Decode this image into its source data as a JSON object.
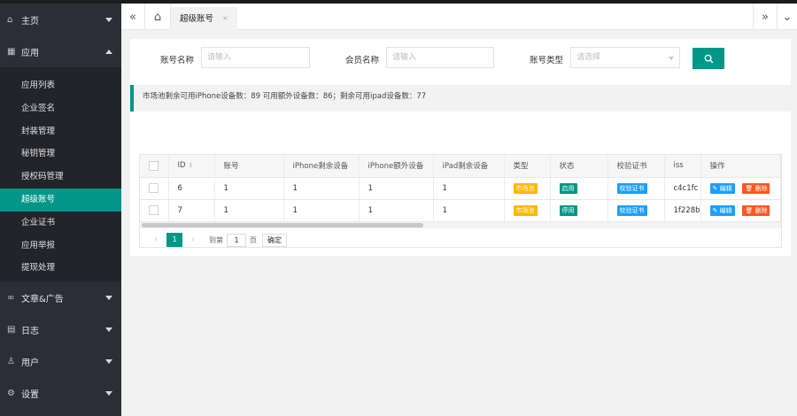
{
  "sidebar": {
    "home": {
      "label": "主页",
      "icon": "home-icon"
    },
    "apps": {
      "label": "应用",
      "icon": "apps-icon"
    },
    "sub_items": [
      "应用列表",
      "企业签名",
      "封装管理",
      "秘钥管理",
      "授权码管理",
      "超级账号",
      "企业证书",
      "应用举报",
      "提现处理"
    ],
    "active_index": 5,
    "articles": {
      "label": "文章&广告",
      "icon": "link-icon"
    },
    "logs": {
      "label": "日志",
      "icon": "log-icon"
    },
    "users": {
      "label": "用户",
      "icon": "user-icon"
    },
    "settings": {
      "label": "设置",
      "icon": "gear-icon"
    }
  },
  "tabs": {
    "active_label": "超级账号",
    "close_symbol": "×"
  },
  "filter": {
    "account_name_label": "账号名称",
    "account_name_placeholder": "请输入",
    "member_name_label": "会员名称",
    "member_name_placeholder": "请输入",
    "account_type_label": "账号类型",
    "account_type_placeholder": "请选择"
  },
  "notice": "市场池剩余可用iPhone设备数：89 可用额外设备数：86；剩余可用ipad设备数：77",
  "table": {
    "headers": [
      "ID",
      "账号",
      "iPhone剩余设备",
      "iPhone额外设备",
      "iPad剩余设备",
      "类型",
      "状态",
      "校验证书",
      "iss",
      "操作"
    ],
    "rows": [
      {
        "id": "6",
        "account": "1",
        "iphone_left": "1",
        "iphone_extra": "1",
        "ipad_left": "1",
        "type": "市场池",
        "status": "启用",
        "cert": "校验证书",
        "iss": "c4c1fc",
        "edit": "编辑",
        "delete": "删除"
      },
      {
        "id": "7",
        "account": "1",
        "iphone_left": "1",
        "iphone_extra": "1",
        "ipad_left": "1",
        "type": "市场池",
        "status": "停用",
        "cert": "校验证书",
        "iss": "1f228b",
        "edit": "编辑",
        "delete": "删除"
      }
    ]
  },
  "pager": {
    "current": "1",
    "goto_label": "到第",
    "goto_value": "1",
    "page_unit": "页",
    "confirm": "确定"
  },
  "colors": {
    "accent": "#009688",
    "sidebar_bg": "#2b2e36",
    "warning": "#ffb800",
    "info": "#1e9fff",
    "danger": "#ff5722"
  }
}
